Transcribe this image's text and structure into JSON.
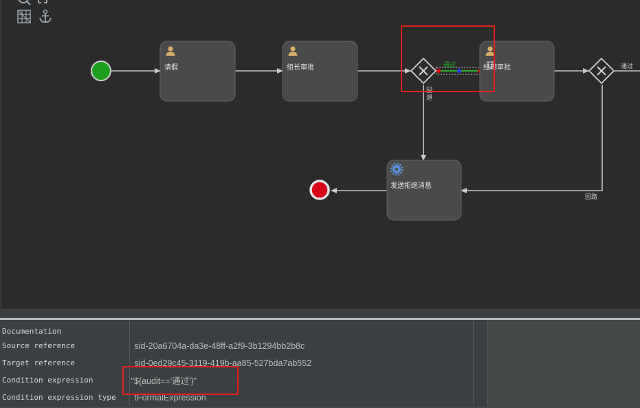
{
  "diagram": {
    "tasks": [
      {
        "id": "qingjia",
        "label": "请假",
        "icon": "user-icon"
      },
      {
        "id": "zuzhang",
        "label": "组长审批",
        "icon": "user-icon"
      },
      {
        "id": "jingli",
        "label": "经理审批",
        "icon": "user-icon"
      },
      {
        "id": "reject",
        "label": "发送拒绝消息",
        "icon": "gear-icon"
      }
    ],
    "edge_labels": {
      "gw1_pass": "通过",
      "gw1_reject": "回退",
      "gw2_pass": "通过",
      "gw2_reject": "回路"
    },
    "colors": {
      "start": "#1e9e1e",
      "end": "#d9001b",
      "task_fill": "#4a4a4a",
      "edge": "#c8c8c8",
      "highlight": "#e3231b",
      "selected_edge": "#2ab52a"
    }
  },
  "properties": {
    "rows": [
      {
        "name": "Documentation",
        "value": ""
      },
      {
        "name": "Source reference",
        "value": "sid-20a6704a-da3e-48ff-a2f9-3b1294bb2b8c"
      },
      {
        "name": "Target reference",
        "value": "sid-0ed29c45-3119-419b-aa85-527bda7ab552"
      },
      {
        "name": "Condition expression",
        "value": "\"${audit=='通过'}\""
      },
      {
        "name": "Condition expression type",
        "value": "tFormalExpression"
      }
    ]
  }
}
